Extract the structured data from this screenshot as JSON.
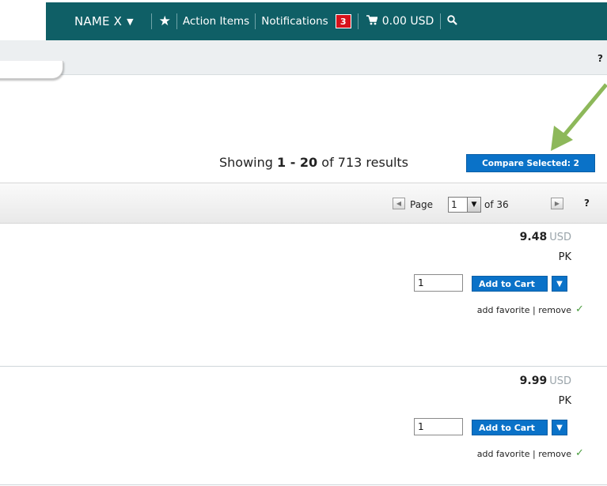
{
  "nav": {
    "user_name": "NAME X",
    "action_items": "Action Items",
    "notifications": "Notifications",
    "notifications_count": "3",
    "cart_amount": "0.00 USD"
  },
  "toolbar": {
    "help": "?"
  },
  "results": {
    "prefix": "Showing ",
    "range": "1 - 20",
    "of": " of ",
    "total": "713",
    "suffix": " results",
    "compare_label": "Compare Selected: 2"
  },
  "pager": {
    "page_label": "Page",
    "current_page": "1",
    "of_label": "of 36",
    "help": "?"
  },
  "products": [
    {
      "price": "9.48",
      "currency": "USD",
      "uom": "PK",
      "qty": "1",
      "add_to_cart": "Add to Cart",
      "add_favorite": "add favorite",
      "separator": " | ",
      "remove": "remove"
    },
    {
      "price": "9.99",
      "currency": "USD",
      "uom": "PK",
      "qty": "1",
      "add_to_cart": "Add to Cart",
      "add_favorite": "add favorite",
      "separator": " | ",
      "remove": "remove"
    }
  ],
  "colors": {
    "nav_bg": "#0f5f66",
    "primary_button": "#0a72c8",
    "badge": "#d7121b",
    "arrow": "#8db85a",
    "check": "#4a9d3f"
  },
  "icons": [
    "caret-down-icon",
    "star-icon",
    "cart-icon",
    "search-icon",
    "arrow-left-icon",
    "arrow-right-icon",
    "check-icon"
  ]
}
